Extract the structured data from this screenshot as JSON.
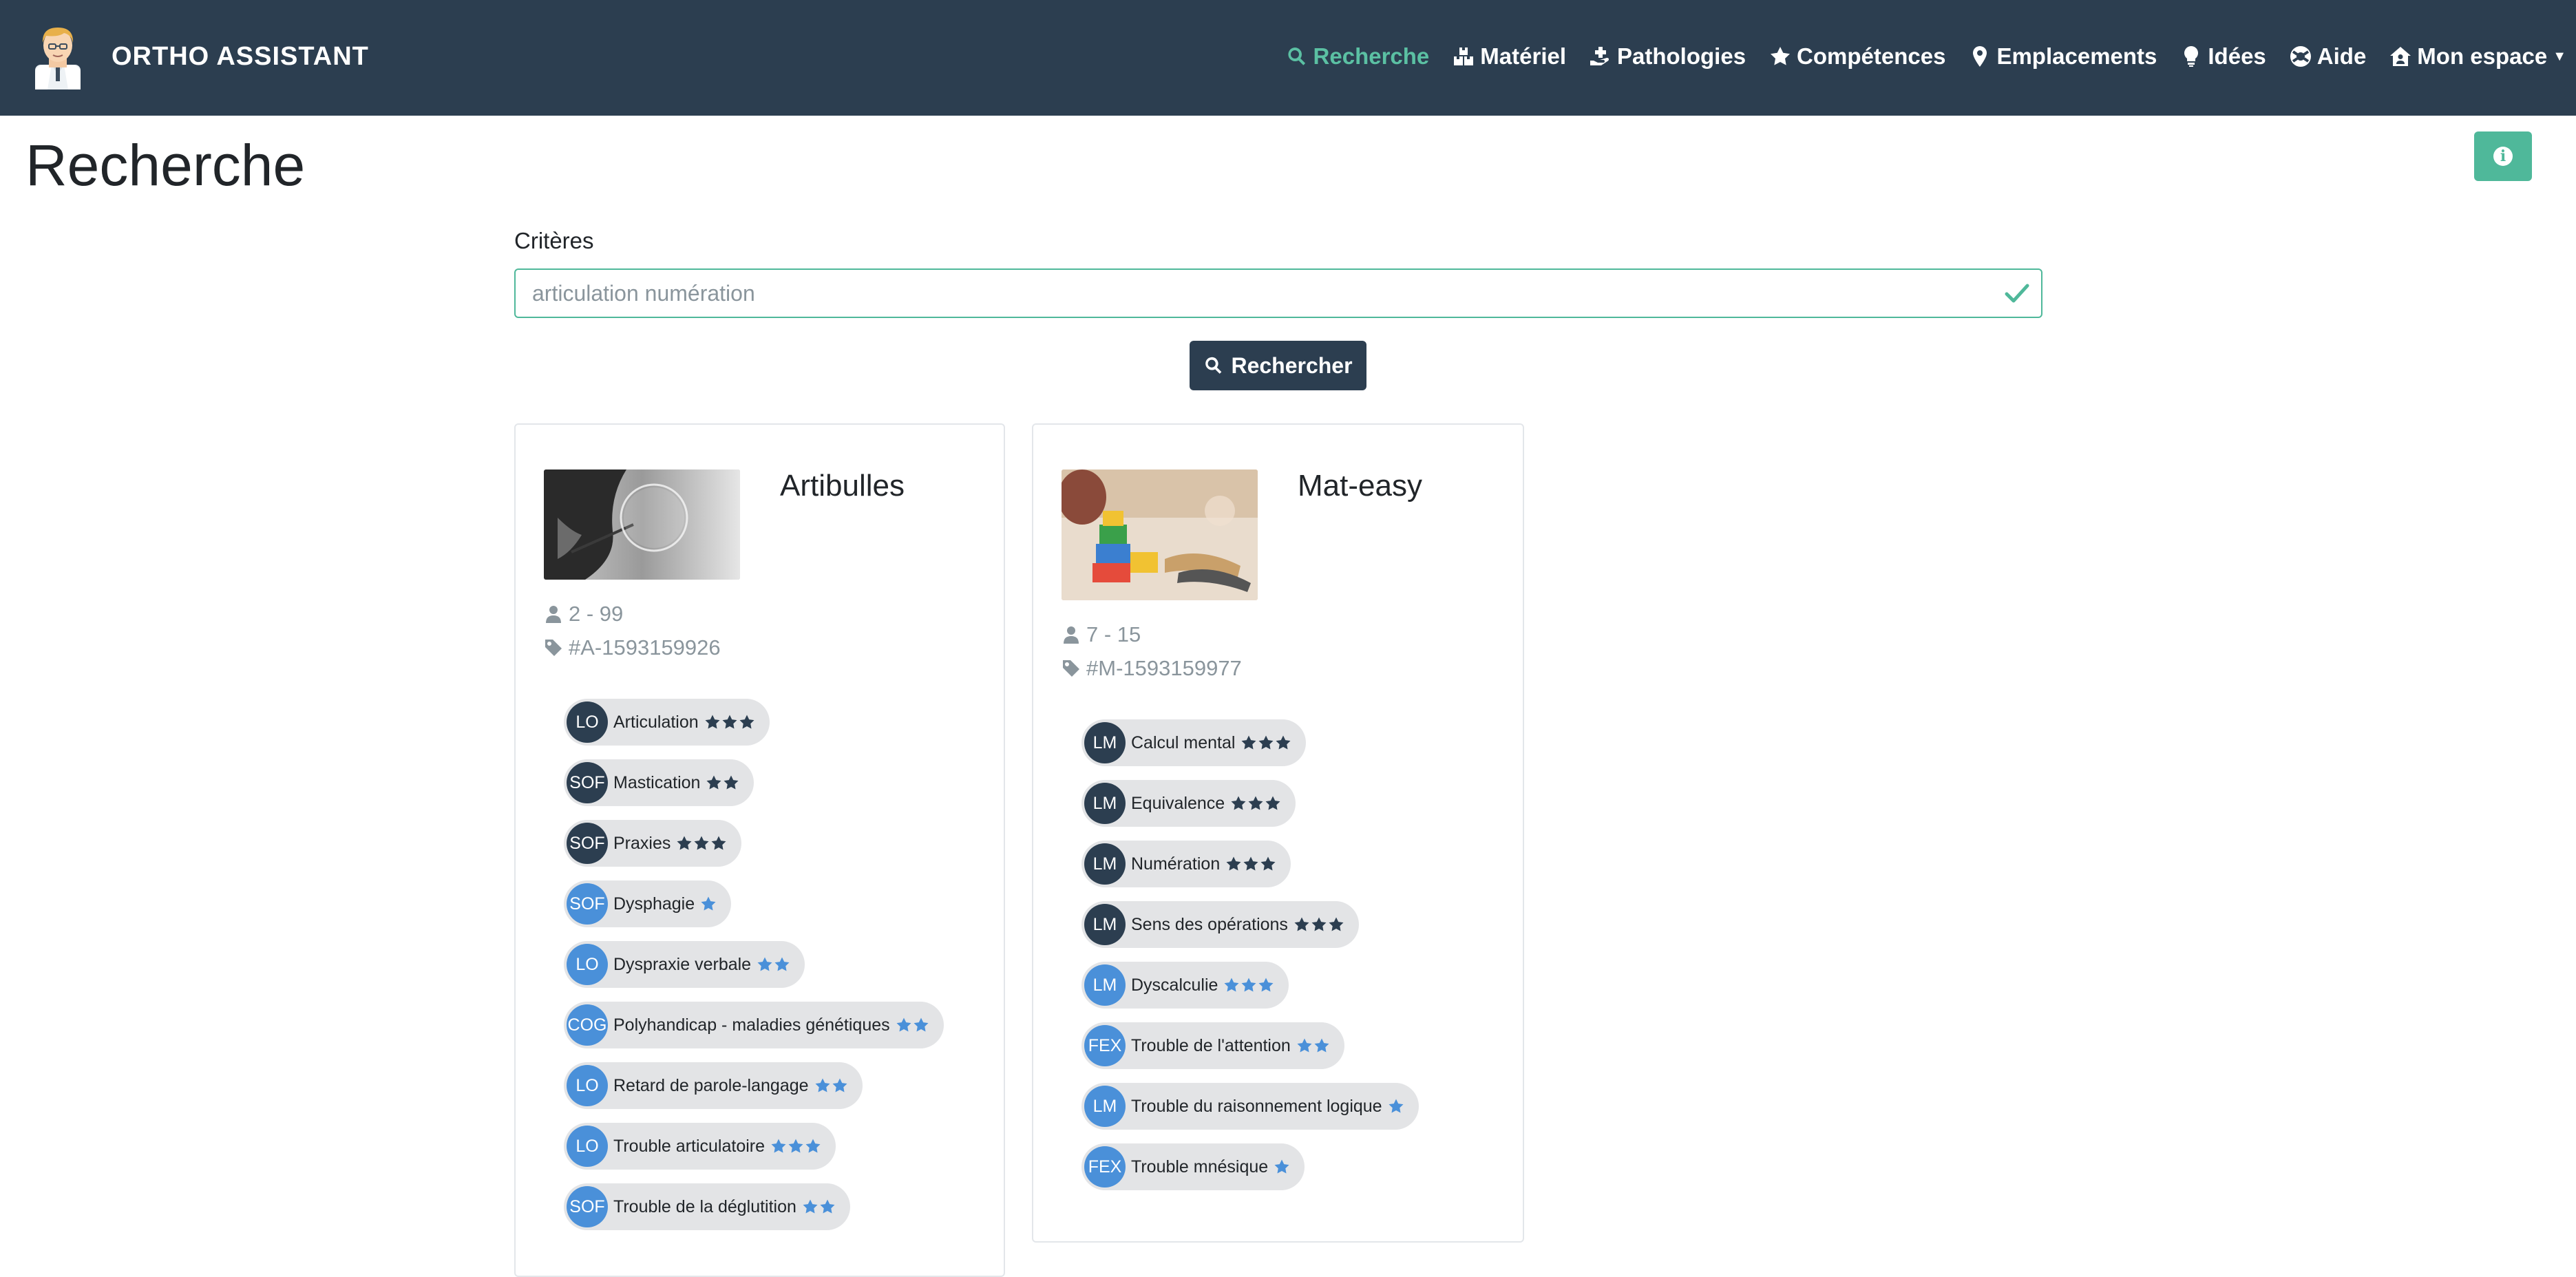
{
  "app": {
    "brand": "ORTHO ASSISTANT"
  },
  "nav": {
    "items": [
      {
        "label": "Recherche",
        "icon": "search-icon",
        "active": true
      },
      {
        "label": "Matériel",
        "icon": "boxes-icon"
      },
      {
        "label": "Pathologies",
        "icon": "hand-holding-medical-icon"
      },
      {
        "label": "Compétences",
        "icon": "star-icon"
      },
      {
        "label": "Emplacements",
        "icon": "map-marker-icon"
      },
      {
        "label": "Idées",
        "icon": "lightbulb-icon"
      },
      {
        "label": "Aide",
        "icon": "life-ring-icon"
      },
      {
        "label": "Mon espace",
        "icon": "house-user-icon",
        "dropdown": true
      }
    ]
  },
  "page": {
    "title": "Recherche",
    "criteria_label": "Critères",
    "search_placeholder": "articulation numération",
    "search_button": "Rechercher"
  },
  "colors": {
    "navbar": "#2c3e50",
    "accent": "#4fb89a",
    "active_nav": "#5bc0a3",
    "badge_dark": "#2c3e50",
    "badge_blue": "#4a90d9"
  },
  "results": [
    {
      "title": "Artibulles",
      "image": "bubble-photo",
      "age": "2 - 99",
      "ref": "#A-1593159926",
      "skills": [
        {
          "code": "LO",
          "label": "Articulation",
          "stars": 3,
          "style": "dark"
        },
        {
          "code": "SOF",
          "label": "Mastication",
          "stars": 2,
          "style": "dark"
        },
        {
          "code": "SOF",
          "label": "Praxies",
          "stars": 3,
          "style": "dark"
        },
        {
          "code": "SOF",
          "label": "Dysphagie",
          "stars": 1,
          "style": "blue"
        },
        {
          "code": "LO",
          "label": "Dyspraxie verbale",
          "stars": 2,
          "style": "blue"
        },
        {
          "code": "COG",
          "label": "Polyhandicap - maladies génétiques",
          "stars": 2,
          "style": "blue"
        },
        {
          "code": "LO",
          "label": "Retard de parole-langage",
          "stars": 2,
          "style": "blue"
        },
        {
          "code": "LO",
          "label": "Trouble articulatoire",
          "stars": 3,
          "style": "blue"
        },
        {
          "code": "SOF",
          "label": "Trouble de la déglutition",
          "stars": 2,
          "style": "blue"
        }
      ]
    },
    {
      "title": "Mat-easy",
      "image": "blocks-photo",
      "age": "7 - 15",
      "ref": "#M-1593159977",
      "skills": [
        {
          "code": "LM",
          "label": "Calcul mental",
          "stars": 3,
          "style": "dark"
        },
        {
          "code": "LM",
          "label": "Equivalence",
          "stars": 3,
          "style": "dark"
        },
        {
          "code": "LM",
          "label": "Numération",
          "stars": 3,
          "style": "dark"
        },
        {
          "code": "LM",
          "label": "Sens des opérations",
          "stars": 3,
          "style": "dark"
        },
        {
          "code": "LM",
          "label": "Dyscalculie",
          "stars": 3,
          "style": "blue"
        },
        {
          "code": "FEX",
          "label": "Trouble de l'attention",
          "stars": 2,
          "style": "blue"
        },
        {
          "code": "LM",
          "label": "Trouble du raisonnement logique",
          "stars": 1,
          "style": "blue"
        },
        {
          "code": "FEX",
          "label": "Trouble mnésique",
          "stars": 1,
          "style": "blue"
        }
      ]
    }
  ]
}
